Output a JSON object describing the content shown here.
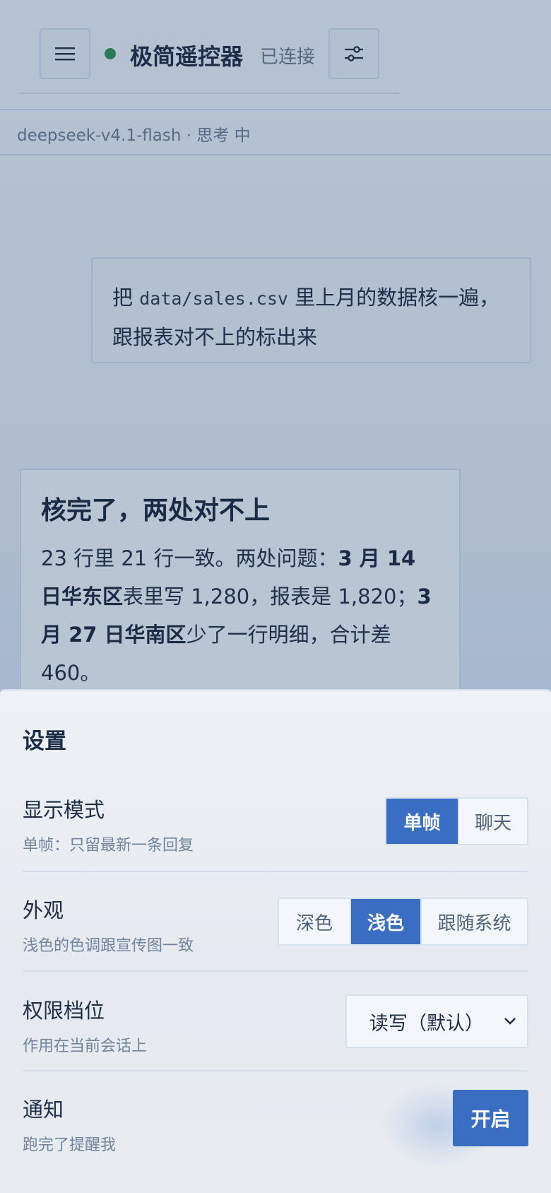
{
  "header": {
    "title": "极简遥控器",
    "connection_status": "已连接",
    "status_color": "#2b7a5a"
  },
  "model_bar": {
    "text": "deepseek-v4.1-flash · 思考 中"
  },
  "messages": {
    "user": {
      "prefix": "把 ",
      "code": "data/sales.csv",
      "suffix": " 里上月的数据核一遍，跟报表对不上的标出来"
    },
    "assistant": {
      "title": "核完了，两处对不上",
      "part1": "23 行里 21 行一致。两处问题：",
      "bold1": "3 月 14 日华东区",
      "part2": "表里写 1,280，报表是 1,820；",
      "bold2": "3 月 27 日华南区",
      "part3": "少了一行明细，合计差 460。"
    }
  },
  "settings": {
    "title": "设置",
    "display_mode": {
      "label": "显示模式",
      "sub": "单帧：只留最新一条回复",
      "options": [
        "单帧",
        "聊天"
      ],
      "selected": "单帧"
    },
    "appearance": {
      "label": "外观",
      "sub": "浅色的色调跟宣传图一致",
      "options": [
        "深色",
        "浅色",
        "跟随系统"
      ],
      "selected": "浅色"
    },
    "permission": {
      "label": "权限档位",
      "sub": "作用在当前会话上",
      "value": "读写（默认）"
    },
    "notification": {
      "label": "通知",
      "sub": "跑完了提醒我",
      "button": "开启"
    }
  },
  "colors": {
    "accent": "#3a6ec2",
    "text_primary": "#1d2c47",
    "text_secondary": "#71849b"
  }
}
